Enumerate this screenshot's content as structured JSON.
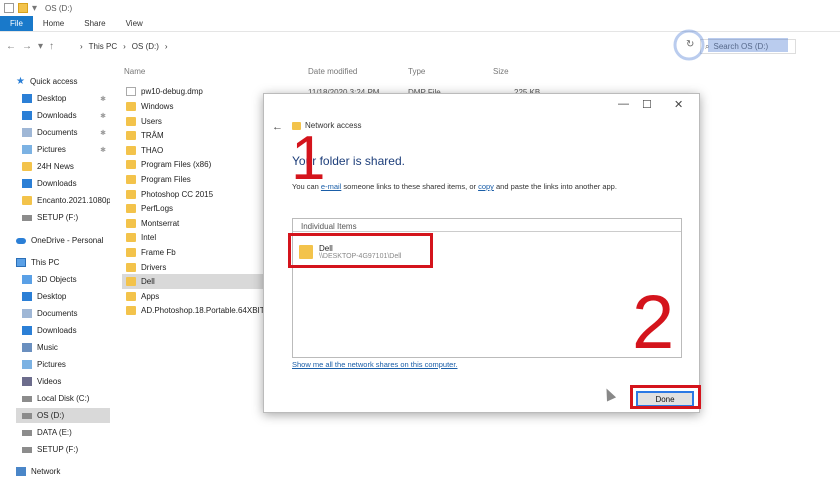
{
  "titlebar": {
    "drive_title": "OS (D:)"
  },
  "ribbon": {
    "tabs": [
      "File",
      "Home",
      "Share",
      "View"
    ]
  },
  "address": {
    "crumbs": [
      "This PC",
      "OS (D:)"
    ],
    "search_placeholder": "Search OS (D:)"
  },
  "sidebar": {
    "items": [
      {
        "label": "Quick access",
        "icon": "star-icon"
      },
      {
        "label": "Desktop",
        "icon": "desktop-folder-icon",
        "pinned": true
      },
      {
        "label": "Downloads",
        "icon": "download-arrow-icon",
        "pinned": true
      },
      {
        "label": "Documents",
        "icon": "documents-icon",
        "pinned": true
      },
      {
        "label": "Pictures",
        "icon": "pictures-icon",
        "pinned": true
      },
      {
        "label": "24H News",
        "icon": "folder-icon"
      },
      {
        "label": "Downloads",
        "icon": "download-arrow-icon"
      },
      {
        "label": "Encanto.2021.1080p",
        "icon": "folder-icon"
      },
      {
        "label": "SETUP (F:)",
        "icon": "drive-icon"
      },
      {
        "label": "OneDrive - Personal",
        "icon": "cloud-icon"
      },
      {
        "label": "This PC",
        "icon": "pc-icon"
      },
      {
        "label": "3D Objects",
        "icon": "3d-objects-icon"
      },
      {
        "label": "Desktop",
        "icon": "desktop-folder-icon"
      },
      {
        "label": "Documents",
        "icon": "documents-icon"
      },
      {
        "label": "Downloads",
        "icon": "download-arrow-icon"
      },
      {
        "label": "Music",
        "icon": "music-icon"
      },
      {
        "label": "Pictures",
        "icon": "pictures-icon"
      },
      {
        "label": "Videos",
        "icon": "videos-icon"
      },
      {
        "label": "Local Disk (C:)",
        "icon": "drive-icon"
      },
      {
        "label": "OS (D:)",
        "icon": "drive-icon",
        "selected": true
      },
      {
        "label": "DATA (E:)",
        "icon": "drive-icon"
      },
      {
        "label": "SETUP (F:)",
        "icon": "drive-icon"
      },
      {
        "label": "Network",
        "icon": "network-icon"
      }
    ]
  },
  "filelist": {
    "headers": {
      "name": "Name",
      "modified": "Date modified",
      "type": "Type",
      "size": "Size"
    },
    "first_file": {
      "name": "pw10-debug.dmp",
      "modified": "11/18/2020 3:24 PM",
      "type": "DMP File",
      "size": "225 KB"
    },
    "folders": [
      "Windows",
      "Users",
      "TRÂM",
      "THAO",
      "Program Files (x86)",
      "Program Files",
      "Photoshop CC 2015",
      "PerfLogs",
      "Montserrat",
      "Intel",
      "Frame Fb",
      "Drivers",
      "Dell",
      "Apps",
      "AD.Photoshop.18.Portable.64XBIT"
    ],
    "selected_folder": "Dell"
  },
  "dialog": {
    "title": "Network access",
    "heading": "Your folder is shared.",
    "subtext_pre": "You can ",
    "subtext_link1": "e-mail",
    "subtext_mid": " someone links to these shared items, or ",
    "subtext_link2": "copy",
    "subtext_post": " and paste the links into another app.",
    "items_header": "Individual Items",
    "item_name": "Dell",
    "item_path": "\\\\DESKTOP-4G97101\\Dell",
    "network_link": "Show me all the network shares on this computer.",
    "done_label": "Done"
  },
  "annotations": {
    "step1": "1",
    "step2": "2",
    "color": "#d4141c"
  },
  "colors": {
    "accent": "#1979ca",
    "folder": "#f3c34b",
    "link": "#1a5ea8"
  }
}
